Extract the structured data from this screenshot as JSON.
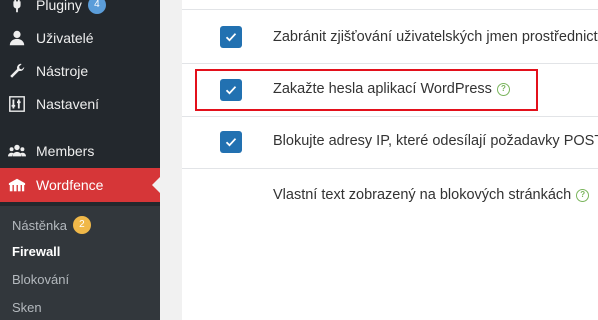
{
  "sidebar": {
    "items": [
      {
        "label": "Pluginy",
        "icon": "plugin-icon",
        "badge": "4"
      },
      {
        "label": "Uživatelé",
        "icon": "user-icon"
      },
      {
        "label": "Nástroje",
        "icon": "wrench-icon"
      },
      {
        "label": "Nastavení",
        "icon": "settings-sliders-icon"
      },
      {
        "label": "Members",
        "icon": "members-group-icon"
      },
      {
        "label": "Wordfence",
        "icon": "wordfence-icon",
        "active": true
      }
    ],
    "submenu": [
      {
        "label": "Nástěnka",
        "badge": "2"
      },
      {
        "label": "Firewall",
        "current": true
      },
      {
        "label": "Blokování"
      },
      {
        "label": "Sken"
      }
    ]
  },
  "settings": {
    "rows": [
      {
        "label": "Zabránit zjišťování uživatelských jmen prostřednictvím",
        "checked": true
      },
      {
        "label": "Zakažte hesla aplikací WordPress",
        "checked": true,
        "help": true
      },
      {
        "label": "Blokujte adresy IP, které odesílají požadavky POST,",
        "checked": true
      },
      {
        "label": "Vlastní text zobrazený na blokových stránkách",
        "help": true
      }
    ]
  },
  "colors": {
    "sidebar_bg": "#23282d",
    "active_bg": "#d63638",
    "checkbox": "#2271b1",
    "highlight_border": "#e3101b"
  }
}
